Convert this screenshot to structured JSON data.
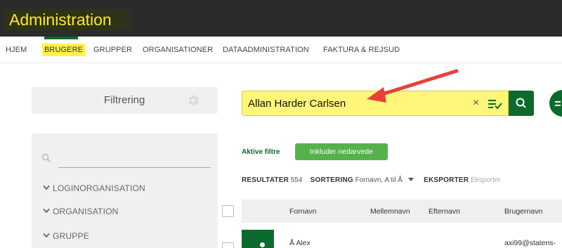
{
  "header": {
    "title": "Administration"
  },
  "nav": {
    "items": [
      {
        "label": "HJEM"
      },
      {
        "label": "BRUGERE",
        "active": true
      },
      {
        "label": "GRUPPER"
      },
      {
        "label": "ORGANISATIONER"
      },
      {
        "label": "DATAADMINISTRATION"
      },
      {
        "label": "FAKTURA & REJSUD"
      }
    ]
  },
  "sidebar": {
    "filter_label": "Filtrering",
    "items": [
      {
        "label": "LOGINORGANISATION"
      },
      {
        "label": "ORGANISATION"
      },
      {
        "label": "GRUPPE"
      }
    ]
  },
  "search": {
    "value": "Allan Harder Carlsen",
    "clear_icon": "close-icon",
    "list_icon": "list-check-icon",
    "button_icon": "search-icon"
  },
  "filters": {
    "active_label": "Aktive filtre",
    "pill_label": "Inkluder nedarvede"
  },
  "results": {
    "label": "RESULTATER",
    "count": "554",
    "sort_label": "SORTERING",
    "sort_value": "Fornavn, A til Å",
    "export_label": "EKSPORTER",
    "export_value": "Eksporter"
  },
  "table": {
    "columns": [
      {
        "label": "Fornavn"
      },
      {
        "label": "Mellemnavn"
      },
      {
        "label": "Efternavn"
      },
      {
        "label": "Brugernavn"
      }
    ],
    "rows": [
      {
        "fornavn": "Å Alex",
        "brugernavn": "axi99@statens-"
      }
    ]
  },
  "colors": {
    "brand_green": "#0c6a2e",
    "highlight_yellow": "#fff24a",
    "pill_green": "#55b24b",
    "header_bg": "#2b2b2b",
    "annotation_arrow": "#e8413a"
  }
}
